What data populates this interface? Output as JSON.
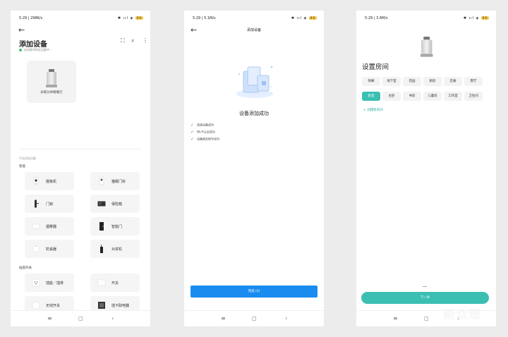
{
  "phone1": {
    "status": {
      "time": "5:29 | 298K/s",
      "battery": "99"
    },
    "title": "添加设备",
    "scanning": "自动搜寻附近设备中...",
    "found_device": "米家分体暖暖灯",
    "section_title": "手动添加设备",
    "group1": "智能",
    "group2": "插座开关",
    "devices": [
      "摄像机",
      "猫眼门铃",
      "门锁",
      "保险箱",
      "烟雾器",
      "智能门",
      "防丢器",
      "对讲机",
      "插座／插排",
      "开关",
      "无线开关",
      "插卡取电器"
    ],
    "icons": [
      "back-arrow-icon",
      "scan-icon",
      "search-icon",
      "more-icon"
    ]
  },
  "phone2": {
    "status": {
      "time": "5:29 | 5.1M/s",
      "battery": "99"
    },
    "header": "添加设备",
    "success_title": "设备添加成功",
    "checks": [
      "连接设备成功",
      "Wi-Fi认证成功",
      "设备绑定账号成功"
    ],
    "button": "完成 (2)"
  },
  "phone3": {
    "status": {
      "time": "5:29 | 3.6M/s",
      "battery": "99"
    },
    "title": "设置房间",
    "rooms": [
      "阳阁",
      "地下室",
      "花园",
      "厨房",
      "走廊",
      "客厅",
      "卧室",
      "主卧",
      "书房",
      "儿童房",
      "工作室",
      "卫生间"
    ],
    "selected_room": "卧室",
    "add_room": "+ 创建新房间",
    "button": "下一步"
  },
  "nav": {
    "menu": "≡",
    "home": "◻",
    "back": "‹"
  },
  "watermark": "新众观",
  "colors": {
    "blue": "#1a8cf0",
    "teal": "#3cbfb3"
  }
}
